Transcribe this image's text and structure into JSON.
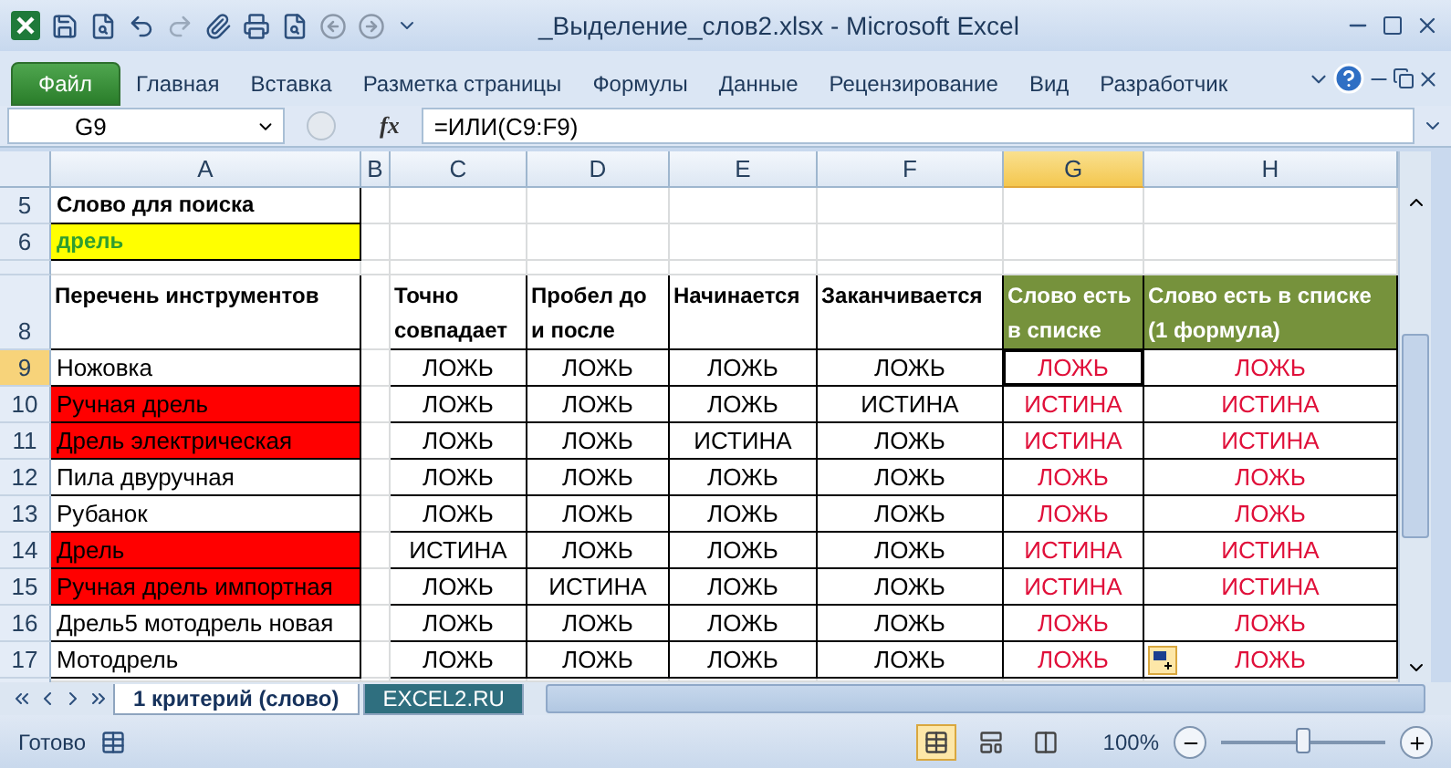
{
  "window": {
    "title": "_Выделение_слов2.xlsx  -  Microsoft Excel"
  },
  "file_tab": "Файл",
  "ribbon_tabs": [
    "Главная",
    "Вставка",
    "Разметка страницы",
    "Формулы",
    "Данные",
    "Рецензирование",
    "Вид",
    "Разработчик"
  ],
  "formula_bar": {
    "name_box": "G9",
    "fx": "fx",
    "formula": "=ИЛИ(C9:F9)"
  },
  "columns": [
    {
      "label": "A",
      "selected": false
    },
    {
      "label": "B",
      "selected": false
    },
    {
      "label": "C",
      "selected": false
    },
    {
      "label": "D",
      "selected": false
    },
    {
      "label": "E",
      "selected": false
    },
    {
      "label": "F",
      "selected": false
    },
    {
      "label": "G",
      "selected": true
    },
    {
      "label": "H",
      "selected": false
    }
  ],
  "search": {
    "label_row": "5",
    "label": "Слово для поиска",
    "value_row": "6",
    "value": "дрель"
  },
  "header_row": {
    "row": "8",
    "cells": [
      {
        "text": "Перечень инструментов",
        "green": false
      },
      {
        "text": "Точно совпадает",
        "green": false
      },
      {
        "text": "Пробел до и после",
        "green": false
      },
      {
        "text": "Начинается",
        "green": false
      },
      {
        "text": "Заканчивается",
        "green": false
      },
      {
        "text": "Слово есть в списке",
        "green": true
      },
      {
        "text": "Слово есть в списке (1 формула)",
        "green": true
      }
    ]
  },
  "rows": [
    {
      "row": "9",
      "selected": true,
      "tool": "Ножовка",
      "highlighted": false,
      "checks": [
        "ЛОЖЬ",
        "ЛОЖЬ",
        "ЛОЖЬ",
        "ЛОЖЬ"
      ],
      "results": [
        "ЛОЖЬ",
        "ЛОЖЬ"
      ]
    },
    {
      "row": "10",
      "selected": false,
      "tool": "Ручная дрель",
      "highlighted": true,
      "checks": [
        "ЛОЖЬ",
        "ЛОЖЬ",
        "ЛОЖЬ",
        "ИСТИНА"
      ],
      "results": [
        "ИСТИНА",
        "ИСТИНА"
      ]
    },
    {
      "row": "11",
      "selected": false,
      "tool": "Дрель электрическая",
      "highlighted": true,
      "checks": [
        "ЛОЖЬ",
        "ЛОЖЬ",
        "ИСТИНА",
        "ЛОЖЬ"
      ],
      "results": [
        "ИСТИНА",
        "ИСТИНА"
      ]
    },
    {
      "row": "12",
      "selected": false,
      "tool": "Пила двуручная",
      "highlighted": false,
      "checks": [
        "ЛОЖЬ",
        "ЛОЖЬ",
        "ЛОЖЬ",
        "ЛОЖЬ"
      ],
      "results": [
        "ЛОЖЬ",
        "ЛОЖЬ"
      ]
    },
    {
      "row": "13",
      "selected": false,
      "tool": "Рубанок",
      "highlighted": false,
      "checks": [
        "ЛОЖЬ",
        "ЛОЖЬ",
        "ЛОЖЬ",
        "ЛОЖЬ"
      ],
      "results": [
        "ЛОЖЬ",
        "ЛОЖЬ"
      ]
    },
    {
      "row": "14",
      "selected": false,
      "tool": "Дрель",
      "highlighted": true,
      "checks": [
        "ИСТИНА",
        "ЛОЖЬ",
        "ЛОЖЬ",
        "ЛОЖЬ"
      ],
      "results": [
        "ИСТИНА",
        "ИСТИНА"
      ]
    },
    {
      "row": "15",
      "selected": false,
      "tool": "Ручная дрель импортная",
      "highlighted": true,
      "checks": [
        "ЛОЖЬ",
        "ИСТИНА",
        "ЛОЖЬ",
        "ЛОЖЬ"
      ],
      "results": [
        "ИСТИНА",
        "ИСТИНА"
      ]
    },
    {
      "row": "16",
      "selected": false,
      "tool": "Дрель5 мотодрель новая",
      "highlighted": false,
      "checks": [
        "ЛОЖЬ",
        "ЛОЖЬ",
        "ЛОЖЬ",
        "ЛОЖЬ"
      ],
      "results": [
        "ЛОЖЬ",
        "ЛОЖЬ"
      ]
    },
    {
      "row": "17",
      "selected": false,
      "tool": "Мотодрель",
      "highlighted": false,
      "checks": [
        "ЛОЖЬ",
        "ЛОЖЬ",
        "ЛОЖЬ",
        "ЛОЖЬ"
      ],
      "results": [
        "ЛОЖЬ",
        "ЛОЖЬ"
      ]
    }
  ],
  "sheet_tabs": [
    {
      "label": "1 критерий (слово)",
      "selected": true
    },
    {
      "label": "EXCEL2.RU",
      "selected": false
    }
  ],
  "status_bar": {
    "status": "Готово",
    "views": [
      {
        "kind": "normal",
        "selected": true
      },
      {
        "kind": "page_layout",
        "selected": false
      },
      {
        "kind": "page_break",
        "selected": false
      }
    ],
    "zoom": "100%",
    "zoom_slider": {
      "level": 0.5
    }
  }
}
